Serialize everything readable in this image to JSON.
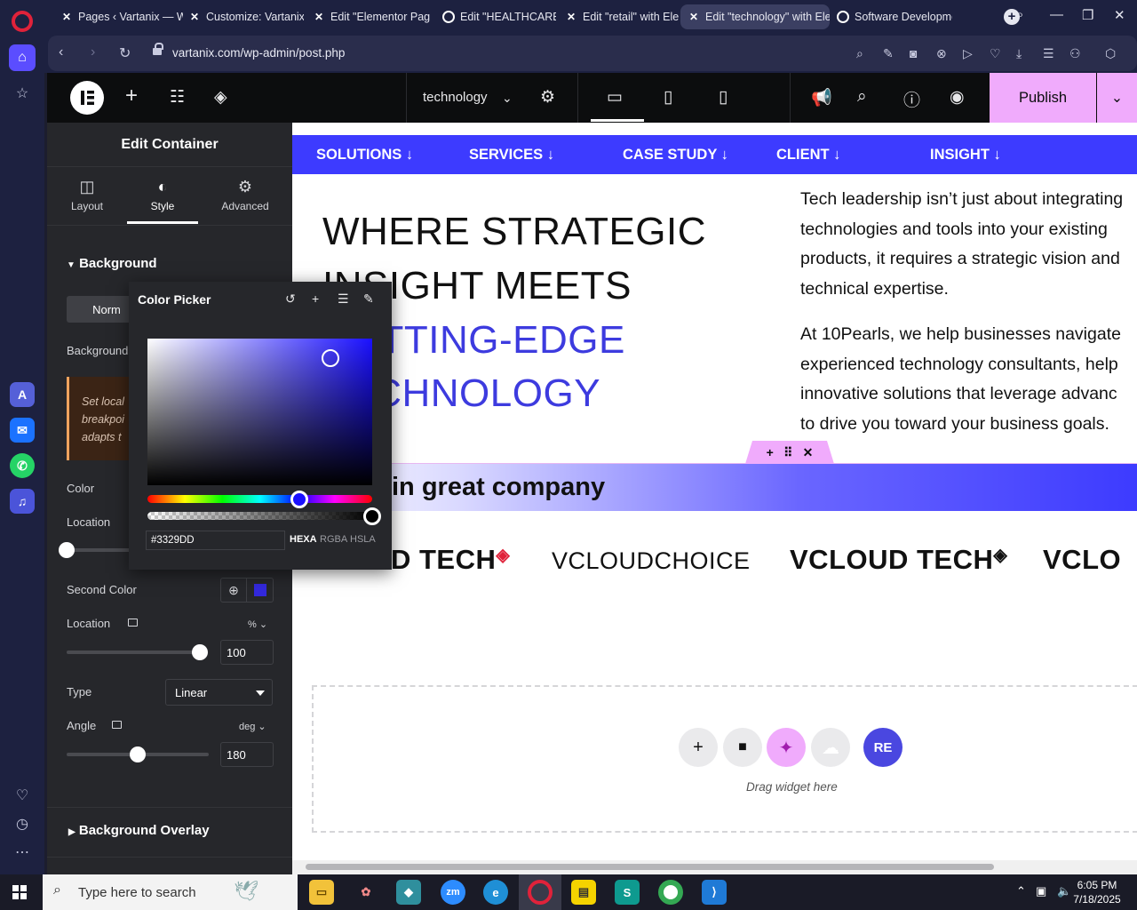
{
  "browser": {
    "tabs": [
      {
        "title": "Pages ‹ Vartanix — W"
      },
      {
        "title": "Customize: Vartanix |"
      },
      {
        "title": "Edit \"Elementor Page"
      },
      {
        "title": "Edit \"HEALTHCARE\" w"
      },
      {
        "title": "Edit \"retail\" with Eler"
      },
      {
        "title": "Edit \"technology\" with Ele"
      },
      {
        "title": "Software Developme"
      }
    ],
    "url": "vartanix.com/wp-admin/post.php"
  },
  "elementor": {
    "page_name": "technology",
    "publish_label": "Publish"
  },
  "panel": {
    "title": "Edit Container",
    "tabs": [
      {
        "label": "Layout"
      },
      {
        "label": "Style"
      },
      {
        "label": "Advanced"
      }
    ],
    "background_section": "Background",
    "normal_label": "Norm",
    "background_label": "Background",
    "note_lines": [
      "Set local",
      "breakpoi",
      "adapts t"
    ],
    "color_label": "Color",
    "location_label": "Location",
    "second_color_label": "Second Color",
    "second_color_hex": "#3329dd",
    "location2_label": "Location",
    "location2_unit": "% ⌄",
    "location2_value": "100",
    "location2_fraction": 1.0,
    "location1_fraction": 0.0,
    "type_label": "Type",
    "type_value": "Linear",
    "angle_label": "Angle",
    "angle_unit": "deg ⌄",
    "angle_value": "180",
    "angle_fraction": 0.5,
    "overlay_section": "Background Overlay"
  },
  "color_picker": {
    "title": "Color Picker",
    "hex_value": "#3329DD",
    "formats": [
      "HEXA",
      "RGBA",
      "HSLA"
    ],
    "active_format": "HEXA"
  },
  "canvas": {
    "nav": [
      "SOLUTIONS ↓",
      "SERVICES ↓",
      "CASE STUDY ↓",
      "CLIENT ↓",
      "INSIGHT ↓"
    ],
    "hero": {
      "line1": "WHERE STRATEGIC",
      "line2": "INSIGHT MEETS",
      "line3": "CUTTING-EDGE",
      "line4": "TECHNOLOGY"
    },
    "paragraph1": [
      "Tech leadership isn’t just about integrating",
      "technologies and tools into your existing",
      "products, it requires a strategic vision and",
      "technical expertise."
    ],
    "paragraph2": [
      "At 10Pearls, we help businesses navigate",
      "experienced technology consultants, help",
      "innovative solutions that leverage advanc",
      "to drive you toward your business goals."
    ],
    "band_text": "in great company",
    "logos": [
      "VCLOUD TECH",
      "VCLOUDCHOICE",
      "VCLOUD TECH",
      "VCLO"
    ],
    "drop_zone_text": "Drag widget here"
  },
  "taskbar": {
    "search_placeholder": "Type here to search",
    "time": "6:05 PM",
    "date": "7/18/2025"
  },
  "colors": {
    "accent_blue": "#3d3bff",
    "publish_pink": "#f0abfc",
    "selected_color": "#3329dd"
  }
}
